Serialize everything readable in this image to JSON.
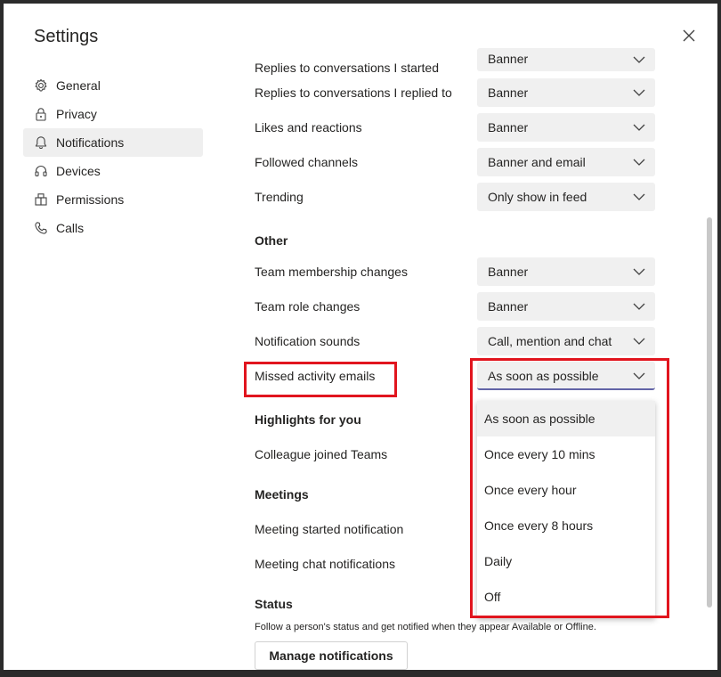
{
  "dialog": {
    "title": "Settings"
  },
  "nav": {
    "items": [
      {
        "label": "General",
        "icon": "gear-icon",
        "active": false
      },
      {
        "label": "Privacy",
        "icon": "lock-icon",
        "active": false
      },
      {
        "label": "Notifications",
        "icon": "bell-icon",
        "active": true
      },
      {
        "label": "Devices",
        "icon": "headset-icon",
        "active": false
      },
      {
        "label": "Permissions",
        "icon": "permissions-icon",
        "active": false
      },
      {
        "label": "Calls",
        "icon": "phone-icon",
        "active": false
      }
    ]
  },
  "rows": {
    "replies_started": {
      "label": "Replies to conversations I started",
      "value": "Banner"
    },
    "replies_replied": {
      "label": "Replies to conversations I replied to",
      "value": "Banner"
    },
    "likes": {
      "label": "Likes and reactions",
      "value": "Banner"
    },
    "followed": {
      "label": "Followed channels",
      "value": "Banner and email"
    },
    "trending": {
      "label": "Trending",
      "value": "Only show in feed"
    },
    "team_membership": {
      "label": "Team membership changes",
      "value": "Banner"
    },
    "team_role": {
      "label": "Team role changes",
      "value": "Banner"
    },
    "sounds": {
      "label": "Notification sounds",
      "value": "Call, mention and chat"
    },
    "missed": {
      "label": "Missed activity emails",
      "value": "As soon as possible"
    },
    "colleague": {
      "label": "Colleague joined Teams"
    },
    "meeting_started": {
      "label": "Meeting started notification"
    },
    "meeting_chat": {
      "label": "Meeting chat notifications"
    }
  },
  "sections": {
    "other": "Other",
    "highlights": "Highlights for you",
    "meetings": "Meetings",
    "status": "Status"
  },
  "dropdown": {
    "options": [
      "As soon as possible",
      "Once every 10 mins",
      "Once every hour",
      "Once every 8 hours",
      "Daily",
      "Off"
    ],
    "selected": "As soon as possible"
  },
  "status": {
    "description": "Follow a person's status and get notified when they appear Available or Offline.",
    "button": "Manage notifications"
  },
  "colors": {
    "accent": "#6264a7",
    "highlight": "#e1151e",
    "select_bg": "#f0f0f0"
  }
}
